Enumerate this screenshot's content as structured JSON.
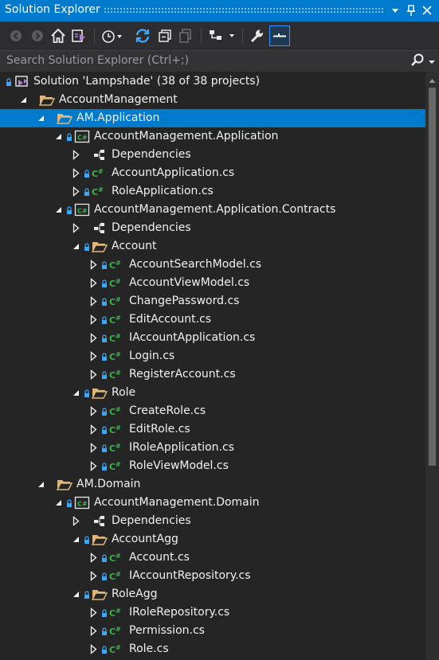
{
  "window": {
    "title": "Solution Explorer",
    "controls": [
      "dropdown",
      "pin",
      "close"
    ]
  },
  "toolbar": {
    "buttons": [
      "back-icon",
      "forward-icon",
      "home-icon",
      "switch-views-icon",
      "pending-changes-filter-icon",
      "sync-icon",
      "collapse-all-icon",
      "show-all-files-icon",
      "properties-icon",
      "preview-icon",
      "wrench-icon",
      "settings-icon"
    ]
  },
  "search": {
    "placeholder": "Search Solution Explorer (Ctrl+;)"
  },
  "colors": {
    "background": "#252526",
    "accent": "#007acc",
    "csharp_icon": "#3bb44a",
    "folder": "#dcb67a",
    "selected_row": "#007acc"
  },
  "tree": [
    {
      "depth": 0,
      "label": "Solution 'Lampshade' (38 of 38 projects)",
      "type": "solution",
      "expander": "none",
      "lock": true
    },
    {
      "depth": 1,
      "label": "AccountManagement",
      "type": "folder-open",
      "expander": "expanded",
      "lock": false
    },
    {
      "depth": 2,
      "label": "AM.Application",
      "type": "folder-open",
      "expander": "expanded",
      "lock": false,
      "selected": true
    },
    {
      "depth": 3,
      "label": "AccountManagement.Application",
      "type": "csproj",
      "expander": "expanded",
      "lock": true
    },
    {
      "depth": 4,
      "label": "Dependencies",
      "type": "dependencies",
      "expander": "collapsed",
      "lock": false
    },
    {
      "depth": 4,
      "label": "AccountApplication.cs",
      "type": "csfile",
      "expander": "collapsed",
      "lock": true
    },
    {
      "depth": 4,
      "label": "RoleApplication.cs",
      "type": "csfile",
      "expander": "collapsed",
      "lock": true
    },
    {
      "depth": 3,
      "label": "AccountManagement.Application.Contracts",
      "type": "csproj",
      "expander": "expanded",
      "lock": true
    },
    {
      "depth": 4,
      "label": "Dependencies",
      "type": "dependencies",
      "expander": "collapsed",
      "lock": false
    },
    {
      "depth": 4,
      "label": "Account",
      "type": "folder-open",
      "expander": "expanded",
      "lock": true
    },
    {
      "depth": 5,
      "label": "AccountSearchModel.cs",
      "type": "csfile",
      "expander": "collapsed",
      "lock": true
    },
    {
      "depth": 5,
      "label": "AccountViewModel.cs",
      "type": "csfile",
      "expander": "collapsed",
      "lock": true
    },
    {
      "depth": 5,
      "label": "ChangePassword.cs",
      "type": "csfile",
      "expander": "collapsed",
      "lock": true
    },
    {
      "depth": 5,
      "label": "EditAccount.cs",
      "type": "csfile",
      "expander": "collapsed",
      "lock": true
    },
    {
      "depth": 5,
      "label": "IAccountApplication.cs",
      "type": "csfile",
      "expander": "collapsed",
      "lock": true
    },
    {
      "depth": 5,
      "label": "Login.cs",
      "type": "csfile",
      "expander": "collapsed",
      "lock": true
    },
    {
      "depth": 5,
      "label": "RegisterAccount.cs",
      "type": "csfile",
      "expander": "collapsed",
      "lock": true
    },
    {
      "depth": 4,
      "label": "Role",
      "type": "folder-open",
      "expander": "expanded",
      "lock": true
    },
    {
      "depth": 5,
      "label": "CreateRole.cs",
      "type": "csfile",
      "expander": "collapsed",
      "lock": true
    },
    {
      "depth": 5,
      "label": "EditRole.cs",
      "type": "csfile",
      "expander": "collapsed",
      "lock": true
    },
    {
      "depth": 5,
      "label": "IRoleApplication.cs",
      "type": "csfile",
      "expander": "collapsed",
      "lock": true
    },
    {
      "depth": 5,
      "label": "RoleViewModel.cs",
      "type": "csfile",
      "expander": "collapsed",
      "lock": true
    },
    {
      "depth": 2,
      "label": "AM.Domain",
      "type": "folder-open",
      "expander": "expanded",
      "lock": false
    },
    {
      "depth": 3,
      "label": "AccountManagement.Domain",
      "type": "csproj",
      "expander": "expanded",
      "lock": true
    },
    {
      "depth": 4,
      "label": "Dependencies",
      "type": "dependencies",
      "expander": "collapsed",
      "lock": false
    },
    {
      "depth": 4,
      "label": "AccountAgg",
      "type": "folder-open",
      "expander": "expanded",
      "lock": true
    },
    {
      "depth": 5,
      "label": "Account.cs",
      "type": "csfile",
      "expander": "collapsed",
      "lock": true
    },
    {
      "depth": 5,
      "label": "IAccountRepository.cs",
      "type": "csfile",
      "expander": "collapsed",
      "lock": true
    },
    {
      "depth": 4,
      "label": "RoleAgg",
      "type": "folder-open",
      "expander": "expanded",
      "lock": true
    },
    {
      "depth": 5,
      "label": "IRoleRepository.cs",
      "type": "csfile",
      "expander": "collapsed",
      "lock": true
    },
    {
      "depth": 5,
      "label": "Permission.cs",
      "type": "csfile",
      "expander": "collapsed",
      "lock": true
    },
    {
      "depth": 5,
      "label": "Role.cs",
      "type": "csfile",
      "expander": "collapsed",
      "lock": true
    }
  ]
}
